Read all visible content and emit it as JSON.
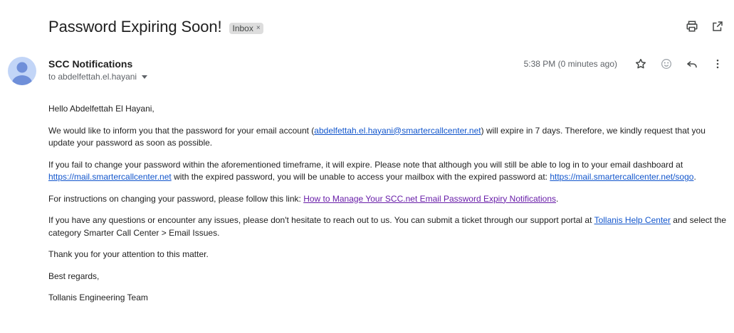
{
  "email": {
    "subject": "Password Expiring Soon!",
    "label": "Inbox",
    "label_remove": "×",
    "sender": "SCC Notifications",
    "recipient": "to abdelfettah.el.hayani",
    "timestamp": "5:38 PM (0 minutes ago)"
  },
  "icons": {
    "print": "printer-icon",
    "open_new": "open-in-new-window-icon",
    "star": "star-icon",
    "emoji": "emoji-reaction-icon",
    "reply": "reply-icon",
    "more": "more-vertical-icon"
  },
  "body": {
    "greeting": "Hello Abdelfettah El Hayani,",
    "p1_a": "We would like to inform you that the password for your email account (",
    "p1_link": "abdelfettah.el.hayani@smartercallcenter.net",
    "p1_b": ") will expire in 7 days. Therefore, we kindly request that you update your password as soon as possible.",
    "p2_a": "If you fail to change your password within the aforementioned timeframe, it will expire. Please note that although you will still be able to log in to your email dashboard at ",
    "p2_link1": "https://mail.smartercallcenter.net",
    "p2_b": " with the expired password, you will be unable to access your mailbox with the expired password at: ",
    "p2_link2": "https://mail.smartercallcenter.net/sogo",
    "p2_c": ".",
    "p3_a": "For instructions on changing your password, please follow this link: ",
    "p3_link": "How to Manage Your SCC.net Email Password Expiry Notifications",
    "p3_b": ".",
    "p4_a": "If you have any questions or encounter any issues, please don't hesitate to reach out to us. You can submit a ticket through our support portal at ",
    "p4_link": "Tollanis Help Center",
    "p4_b": " and select the category Smarter Call Center > Email Issues.",
    "p5": "Thank you for your attention to this matter.",
    "p6": "Best regards,",
    "p7": "Tollanis Engineering Team"
  },
  "colors": {
    "link": "#1155cc",
    "link_visited": "#681da8",
    "avatar_bg": "#c2d5f7",
    "avatar_fg": "#6f8fd9"
  }
}
